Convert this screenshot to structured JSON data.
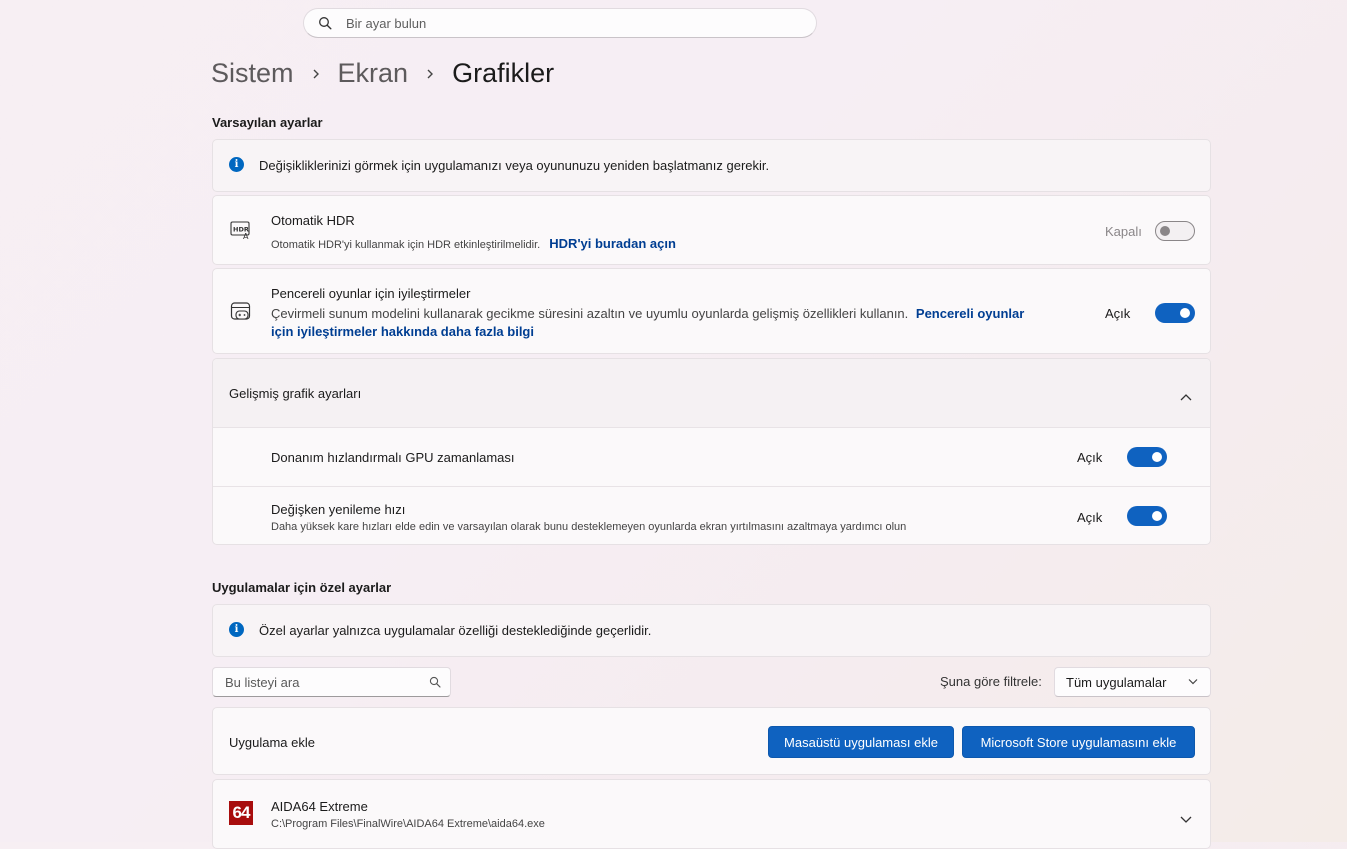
{
  "search": {
    "placeholder": "Bir ayar bulun",
    "icon": "search-icon"
  },
  "breadcrumb": {
    "items": [
      "Sistem",
      "Ekran",
      "Grafikler"
    ]
  },
  "default_settings": {
    "title": "Varsayılan ayarlar",
    "info": "Değişikliklerinizi görmek için uygulamanızı veya oyununuzu yeniden başlatmanız gerekir.",
    "auto_hdr": {
      "title": "Otomatik HDR",
      "description": "Otomatik HDR'yi kullanmak için HDR etkinleştirilmelidir.",
      "link": "HDR'yi buradan açın",
      "state_label": "Kapalı",
      "enabled": false
    },
    "windowed_games": {
      "title": "Pencereli oyunlar için iyileştirmeler",
      "description": "Çevirmeli sunum modelini kullanarak gecikme süresini azaltın ve uyumlu oyunlarda gelişmiş özellikleri kullanın.",
      "link_part1": "Pencereli oyunlar",
      "link_part2": "için iyileştirmeler hakkında daha fazla bilgi",
      "state_label": "Açık",
      "enabled": true
    },
    "advanced": {
      "title": "Gelişmiş grafik ayarları",
      "expanded": true,
      "gpu_scheduling": {
        "title": "Donanım hızlandırmalı GPU zamanlaması",
        "state_label": "Açık",
        "enabled": true
      },
      "vrr": {
        "title": "Değişken yenileme hızı",
        "description": "Daha yüksek kare hızları elde edin ve varsayılan olarak bunu desteklemeyen oyunlarda ekran yırtılmasını azaltmaya yardımcı olun",
        "state_label": "Açık",
        "enabled": true
      }
    }
  },
  "custom_settings": {
    "title": "Uygulamalar için özel ayarlar",
    "info": "Özel ayarlar yalnızca uygulamalar özelliği desteklediğinde geçerlidir.",
    "list_search_placeholder": "Bu listeyi ara",
    "filter_label": "Şuna göre filtrele:",
    "filter_value": "Tüm uygulamalar",
    "add_app": {
      "label": "Uygulama ekle",
      "desktop_button": "Masaüstü uygulaması ekle",
      "store_button": "Microsoft Store uygulamasını ekle"
    },
    "apps": [
      {
        "logo_text": "64",
        "name": "AIDA64 Extreme",
        "path": "C:\\Program Files\\FinalWire\\AIDA64 Extreme\\aida64.exe"
      }
    ]
  },
  "colors": {
    "accent": "#0f62c0",
    "link": "#003e92",
    "app_logo": "#a80d0d"
  }
}
